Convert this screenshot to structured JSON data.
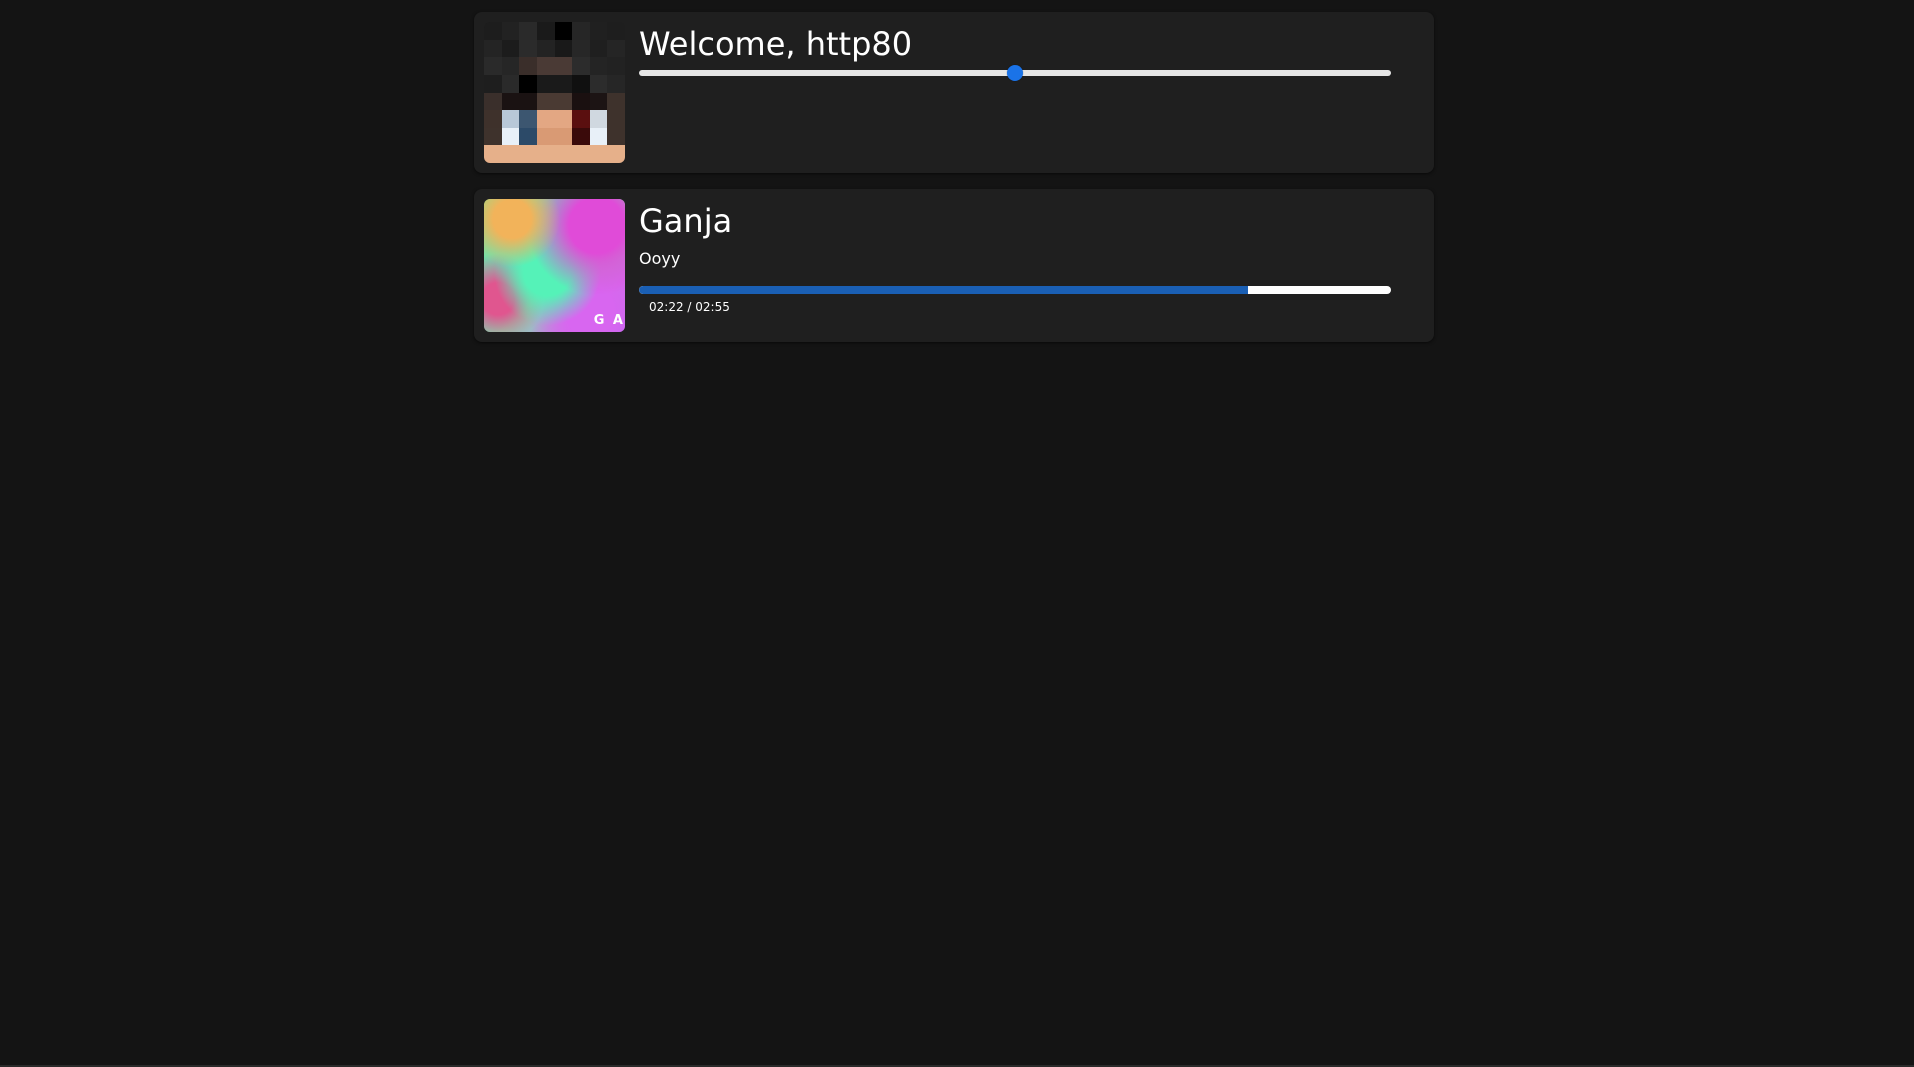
{
  "user_card": {
    "greeting": "Welcome, http80",
    "avatar_alt": "avatar",
    "volume_value": 0.5
  },
  "player_card": {
    "track_title": "Ganja",
    "artist": "Ooyy",
    "time_display": "02:22 / 02:55",
    "progress_value": 0.81,
    "album_art_mark": "G A"
  },
  "colors": {
    "background": "#141414",
    "card": "#1f1f1f",
    "accent": "#1a73e8",
    "progress": "#1a5fb4"
  }
}
